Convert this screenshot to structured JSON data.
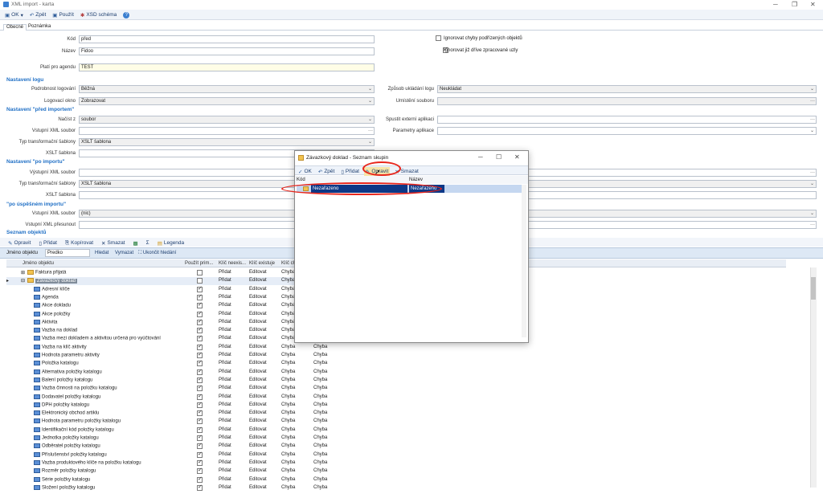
{
  "window": {
    "title": "XML import - karta"
  },
  "toolbar": {
    "ok": "OK",
    "back": "Zpět",
    "apply": "Použít",
    "xsd": "XSD schéma"
  },
  "tabs": [
    "Obecné",
    "Poznámka"
  ],
  "form": {
    "kod_label": "Kód",
    "kod_value": "před",
    "nazev_label": "Název",
    "nazev_value": "Fidoo",
    "agenda_label": "Platí pro agendu",
    "agenda_value": "TEST",
    "ignore1": "Ignorovat chyby podřízených objektů",
    "ignore2": "Ignorovat již dříve zpracované uzly"
  },
  "log": {
    "section": "Nastavení logu",
    "podrobnost_label": "Podrobnost logování",
    "podrobnost_value": "Běžná",
    "okno_label": "Logovací okno",
    "okno_value": "Zobrazovat",
    "zpusob_label": "Způsob ukládání logu",
    "zpusob_value": "Neukládat",
    "umisteni_label": "Umístění souboru"
  },
  "pred": {
    "section": "Nastavení \"před importem\"",
    "nacist_label": "Načíst z",
    "nacist_value": "soubor",
    "vstupni_label": "Vstupní XML soubor",
    "typ_label": "Typ transformační šablony",
    "typ_value": "XSLT šablona",
    "xslt_label": "XSLT šablona",
    "spustit_label": "Spustit externí aplikaci",
    "parametry_label": "Parametry aplikace"
  },
  "po": {
    "section": "Nastavení \"po importu\"",
    "vystupni_label": "Výstupní XML soubor",
    "typ_label": "Typ transformační šablony",
    "typ_value": "XSLT šablona",
    "xslt_label": "XSLT šablona"
  },
  "uspesny": {
    "section": "\"po úspěšném importu\"",
    "vstupni_label": "Vstupní XML soubor",
    "vstupni_value": "(nic)",
    "presunout_label": "Vstupní XML přesunout"
  },
  "objects": {
    "section": "Seznam objektů",
    "toolbar": {
      "edit": "Opravit",
      "add": "Přidat",
      "copy": "Kopírovat",
      "delete": "Smazat",
      "legend": "Legenda"
    },
    "search": {
      "label": "Jméno objektu",
      "value": "Predko",
      "find": "Hledat",
      "clear": "Vymazat",
      "end": "Ukončit hledání"
    },
    "columns": [
      "Jméno objektu",
      "Použít prim...",
      "Klíč neexis...",
      "Klíč existuje",
      "Klíč ch"
    ],
    "rows": [
      {
        "name": "Faktura přijatá",
        "type": "folder",
        "chk": false,
        "a": "Přidat",
        "b": "Editovat",
        "c": "Chyba",
        "level": 0
      },
      {
        "name": "Závazkový doklad",
        "type": "folder",
        "chk": false,
        "a": "Přidat",
        "b": "Editovat",
        "c": "Chyba",
        "level": 0,
        "selected": true
      },
      {
        "name": "Adresní klíče",
        "type": "item",
        "chk": true,
        "a": "Přidat",
        "b": "Editovat",
        "c": "Chyba",
        "level": 1
      },
      {
        "name": "Agenda",
        "type": "item",
        "chk": true,
        "a": "Přidat",
        "b": "Editovat",
        "c": "Chyba",
        "level": 1
      },
      {
        "name": "Akce dokladu",
        "type": "item",
        "chk": true,
        "a": "Přidat",
        "b": "Editovat",
        "c": "Chyba",
        "level": 1
      },
      {
        "name": "Akce položky",
        "type": "item",
        "chk": true,
        "a": "Přidat",
        "b": "Editovat",
        "c": "Chyba",
        "level": 1
      },
      {
        "name": "Aktivita",
        "type": "item",
        "chk": true,
        "a": "Přidat",
        "b": "Editovat",
        "c": "Chyba",
        "level": 1
      },
      {
        "name": "Vazba na doklad",
        "type": "item",
        "chk": true,
        "a": "Přidat",
        "b": "Editovat",
        "c": "Chyba",
        "level": 1
      },
      {
        "name": "Vazba mezi dokladem a aktivitou určená pro vyúčtování",
        "type": "item",
        "chk": true,
        "a": "Přidat",
        "b": "Editovat",
        "c": "Chyba",
        "level": 1
      },
      {
        "name": "Vazba na klíč aktivity",
        "type": "item",
        "chk": true,
        "a": "Přidat",
        "b": "Editovat",
        "c": "Chyba",
        "level": 1
      },
      {
        "name": "Hodnota parametru aktivity",
        "type": "item",
        "chk": true,
        "a": "Přidat",
        "b": "Editovat",
        "c": "Chyba",
        "level": 1
      },
      {
        "name": "Položka katalogu",
        "type": "item",
        "chk": true,
        "a": "Přidat",
        "b": "Editovat",
        "c": "Chyba",
        "level": 1
      },
      {
        "name": "Alternativa položky katalogu",
        "type": "item",
        "chk": true,
        "a": "Přidat",
        "b": "Editovat",
        "c": "Chyba",
        "level": 1
      },
      {
        "name": "Balení položky katalogu",
        "type": "item",
        "chk": true,
        "a": "Přidat",
        "b": "Editovat",
        "c": "Chyba",
        "level": 1
      },
      {
        "name": "Vazba činnosti na položku katalogu",
        "type": "item",
        "chk": true,
        "a": "Přidat",
        "b": "Editovat",
        "c": "Chyba",
        "level": 1
      },
      {
        "name": "Dodavatel položky katalogu",
        "type": "item",
        "chk": true,
        "a": "Přidat",
        "b": "Editovat",
        "c": "Chyba",
        "level": 1
      },
      {
        "name": "DPH položky katalogu",
        "type": "item",
        "chk": true,
        "a": "Přidat",
        "b": "Editovat",
        "c": "Chyba",
        "level": 1
      },
      {
        "name": "Elektronický obchod artiklu",
        "type": "item",
        "chk": true,
        "a": "Přidat",
        "b": "Editovat",
        "c": "Chyba",
        "level": 1
      },
      {
        "name": "Hodnota parametru položky katalogu",
        "type": "item",
        "chk": true,
        "a": "Přidat",
        "b": "Editovat",
        "c": "Chyba",
        "level": 1
      },
      {
        "name": "Identifikační kód položky katalogu",
        "type": "item",
        "chk": true,
        "a": "Přidat",
        "b": "Editovat",
        "c": "Chyba",
        "level": 1
      },
      {
        "name": "Jednotka položky katalogu",
        "type": "item",
        "chk": true,
        "a": "Přidat",
        "b": "Editovat",
        "c": "Chyba",
        "level": 1
      },
      {
        "name": "Odběratel položky katalogu",
        "type": "item",
        "chk": true,
        "a": "Přidat",
        "b": "Editovat",
        "c": "Chyba",
        "level": 1
      },
      {
        "name": "Příslušenství položky katalogu",
        "type": "item",
        "chk": true,
        "a": "Přidat",
        "b": "Editovat",
        "c": "Chyba",
        "level": 1
      },
      {
        "name": "Vazba produktového klíče na položku katalogu",
        "type": "item",
        "chk": true,
        "a": "Přidat",
        "b": "Editovat",
        "c": "Chyba",
        "level": 1
      },
      {
        "name": "Rozměr položky katalogu",
        "type": "item",
        "chk": true,
        "a": "Přidat",
        "b": "Editovat",
        "c": "Chyba",
        "level": 1
      },
      {
        "name": "Série položky katalogu",
        "type": "item",
        "chk": true,
        "a": "Přidat",
        "b": "Editovat",
        "c": "Chyba",
        "level": 1
      },
      {
        "name": "Složení položky katalogu",
        "type": "item",
        "chk": true,
        "a": "Přidat",
        "b": "Editovat",
        "c": "Chyba",
        "level": 1
      }
    ]
  },
  "dialog": {
    "title": "Závazkový doklad - Seznam skupin",
    "toolbar": {
      "ok": "OK",
      "back": "Zpět",
      "add": "Přidat",
      "edit": "Opravit",
      "delete": "Smazat"
    },
    "columns": [
      "Kód",
      "Název"
    ],
    "row": {
      "kod": "Nezařazeno",
      "nazev": "Nezařazeno"
    }
  },
  "colors": {
    "accent": "#1f6fc5",
    "highlight": "#0c3887",
    "annotation": "#e8261c"
  }
}
